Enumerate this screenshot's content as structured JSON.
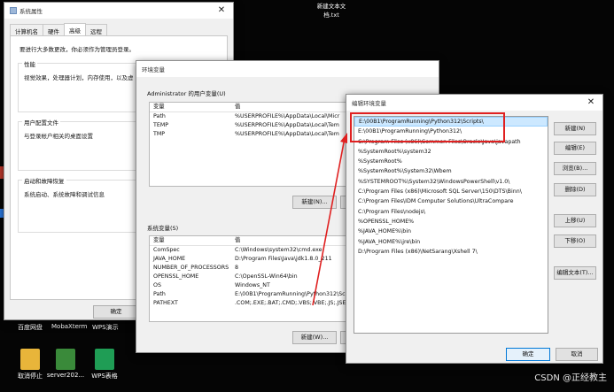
{
  "desktop": {
    "top_file_line1": "新建文本文",
    "top_file_line2": "档.txt",
    "label_row": [
      "百度网盘",
      "MobaXterm",
      "WPS演示"
    ],
    "icons": [
      {
        "label": "取消停止",
        "color": "#e8b53a"
      },
      {
        "label": "server202...",
        "color": "#3a8a3a"
      },
      {
        "label": "WPS表格",
        "color": "#1f9d55"
      }
    ],
    "watermark": "CSDN @正经教主"
  },
  "sys_props": {
    "title": "系统属性",
    "tabs": [
      "计算机名",
      "硬件",
      "高级",
      "远程"
    ],
    "active_tab": "高级",
    "admin_note": "要进行大多数更改，你必须作为管理员登录。",
    "perf_title": "性能",
    "perf_text": "视觉效果，处理器计划，内存使用，以及虚",
    "profile_title": "用户配置文件",
    "profile_text": "与登录帐户相关的桌面设置",
    "startup_title": "启动和故障恢复",
    "startup_text": "系统启动、系统故障和调试信息",
    "ok": "确定"
  },
  "env_vars": {
    "title": "环境变量",
    "user_section": "Administrator 的用户变量(U)",
    "col_var": "变量",
    "col_val": "值",
    "user_vars": [
      {
        "name": "Path",
        "value": "%USERPROFILE%\\AppData\\Local\\Micr"
      },
      {
        "name": "TEMP",
        "value": "%USERPROFILE%\\AppData\\Local\\Tem"
      },
      {
        "name": "TMP",
        "value": "%USERPROFILE%\\AppData\\Local\\Tem"
      }
    ],
    "new_user": "新建(N)...",
    "sys_section": "系统变量(S)",
    "sys_vars": [
      {
        "name": "ComSpec",
        "value": "C:\\Windows\\system32\\cmd.exe"
      },
      {
        "name": "JAVA_HOME",
        "value": "D:\\Program Files\\Java\\jdk1.8.0_211"
      },
      {
        "name": "NUMBER_OF_PROCESSORS",
        "value": "8"
      },
      {
        "name": "OPENSSL_HOME",
        "value": "C:\\OpenSSL-Win64\\bin"
      },
      {
        "name": "OS",
        "value": "Windows_NT"
      },
      {
        "name": "Path",
        "value": "E:\\00B1\\ProgramRunning\\Python312\\Scri"
      },
      {
        "name": "PATHEXT",
        "value": ".COM;.EXE;.BAT;.CMD;.VBS;.VBE;.JS;.JSE"
      }
    ],
    "new_sys": "新建(W)..."
  },
  "edit_env": {
    "title": "编辑环境变量",
    "entries": [
      "E:\\00B1\\ProgramRunning\\Python312\\Scripts\\",
      "E:\\00B1\\ProgramRunning\\Python312\\",
      "C:\\Program Files (x86)\\Common Files\\Oracle\\Java\\javapath",
      "%SystemRoot%\\system32",
      "%SystemRoot%",
      "%SystemRoot%\\System32\\Wbem",
      "%SYSTEMROOT%\\System32\\WindowsPowerShell\\v1.0\\",
      "C:\\Program Files (x86)\\Microsoft SQL Server\\150\\DTS\\Binn\\",
      "C:\\Program Files\\IDM Computer Solutions\\UltraCompare",
      "C:\\Program Files\\nodejs\\",
      "%OPENSSL_HOME%",
      "%JAVA_HOME%\\bin",
      "%JAVA_HOME%\\jre\\bin",
      "D:\\Program Files (x86)\\NetSarang\\Xshell 7\\"
    ],
    "selected_index": 0,
    "buttons": {
      "new": "新建(N)",
      "edit": "编辑(E)",
      "browse": "浏览(B)...",
      "delete": "删除(D)",
      "up": "上移(U)",
      "down": "下移(O)",
      "edit_text": "编辑文本(T)..."
    },
    "ok": "确定",
    "cancel": "取消",
    "highlight_color": "#e02020"
  }
}
